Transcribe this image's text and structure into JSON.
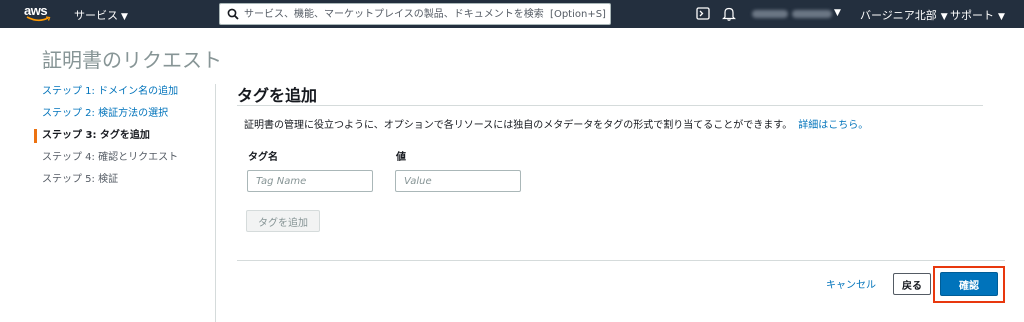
{
  "nav": {
    "logo_text": "aws",
    "services_label": "サービス",
    "search_placeholder": "サービス、機能、マーケットプレイスの製品、ドキュメントを検索  [Option+S]",
    "region_label": "バージニア北部",
    "support_label": "サポート",
    "caret": "▼"
  },
  "page": {
    "title": "証明書のリクエスト"
  },
  "steps": [
    {
      "label": "ステップ 1: ドメイン名の追加",
      "state": "link"
    },
    {
      "label": "ステップ 2: 検証方法の選択",
      "state": "link"
    },
    {
      "label": "ステップ 3: タグを追加",
      "state": "current"
    },
    {
      "label": "ステップ 4: 確認とリクエスト",
      "state": "plain"
    },
    {
      "label": "ステップ 5: 検証",
      "state": "plain"
    }
  ],
  "main": {
    "section_title": "タグを追加",
    "description": "証明書の管理に役立つように、オプションで各リソースには独自のメタデータをタグの形式で割り当てることができます。",
    "learn_more": "詳細はこちら。",
    "tag_name_label": "タグ名",
    "tag_value_label": "値",
    "tag_name_placeholder": "Tag Name",
    "tag_value_placeholder": "Value",
    "add_tag_button": "タグを追加"
  },
  "footer": {
    "cancel": "キャンセル",
    "back": "戻る",
    "confirm": "確認"
  },
  "colors": {
    "nav_bg": "#232f3e",
    "link": "#0073bb",
    "primary_button": "#0073bb",
    "current_step_bar": "#ec7211",
    "highlight_box": "#e8380e"
  }
}
